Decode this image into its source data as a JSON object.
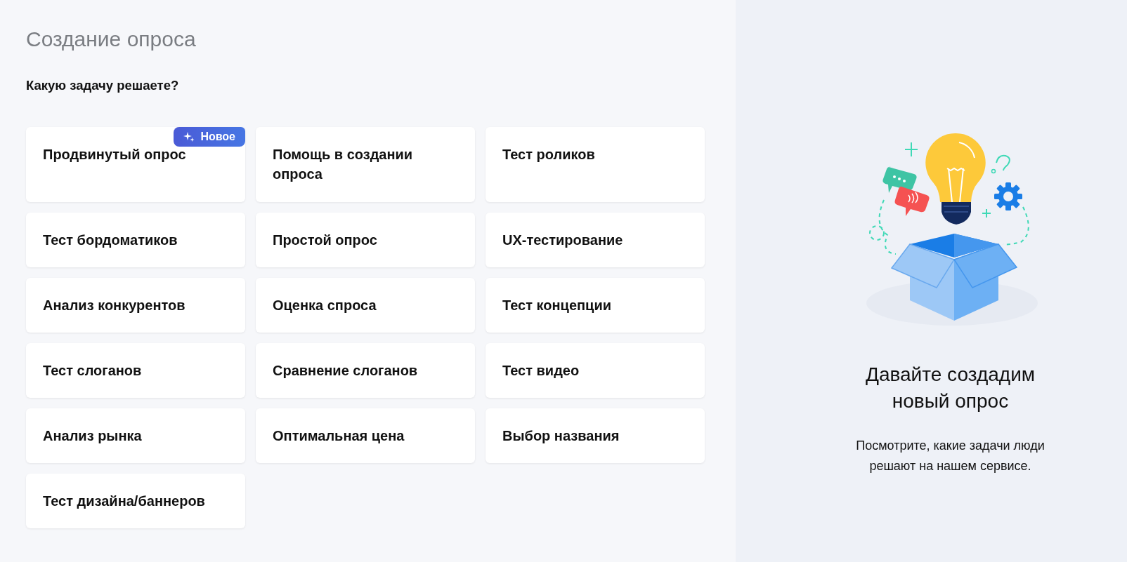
{
  "title": "Создание опроса",
  "question": "Какую задачу решаете?",
  "cards": [
    {
      "label": "Продвинутый опрос",
      "badge": "Новое"
    },
    {
      "label": "Помощь в создании опроса"
    },
    {
      "label": "Тест роликов"
    },
    {
      "label": "Тест бордоматиков"
    },
    {
      "label": "Простой опрос"
    },
    {
      "label": "UX-тестирование"
    },
    {
      "label": "Анализ конкурентов"
    },
    {
      "label": "Оценка спроса"
    },
    {
      "label": "Тест концепции"
    },
    {
      "label": "Тест слоганов"
    },
    {
      "label": "Сравнение слоганов"
    },
    {
      "label": "Тест видео"
    },
    {
      "label": "Анализ рынка"
    },
    {
      "label": "Оптимальная цена"
    },
    {
      "label": "Выбор названия"
    },
    {
      "label": "Тест дизайна/баннеров"
    }
  ],
  "promo": {
    "heading": "Давайте создадим новый опрос",
    "text": "Посмотрите, какие задачи люди решают на нашем сервисе."
  }
}
